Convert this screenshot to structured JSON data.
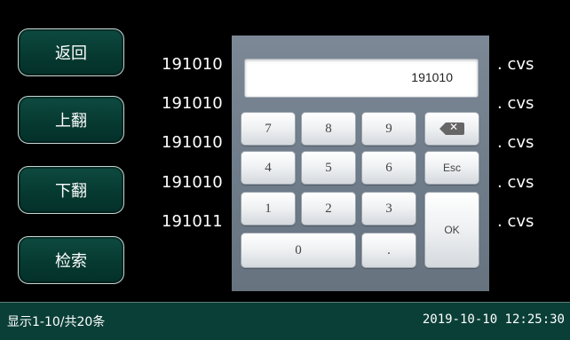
{
  "nav": {
    "back": "返回",
    "page_up": "上翻",
    "page_down": "下翻",
    "search": "检索"
  },
  "file_list": [
    {
      "name": "191010",
      "ext": ". cvs"
    },
    {
      "name": "191010",
      "ext": ". cvs"
    },
    {
      "name": "191010",
      "ext": ". cvs"
    },
    {
      "name": "191010",
      "ext": ". cvs"
    },
    {
      "name": "191011",
      "ext": ". cvs"
    }
  ],
  "keypad": {
    "display_value": "191010",
    "keys": {
      "k7": "7",
      "k8": "8",
      "k9": "9",
      "k4": "4",
      "k5": "5",
      "k6": "6",
      "k1": "1",
      "k2": "2",
      "k3": "3",
      "k0": "0",
      "dot": ".",
      "esc": "Esc",
      "ok": "OK",
      "backspace_icon": "backspace-icon"
    }
  },
  "status": {
    "summary": "显示1-10/共20条",
    "datetime": "2019-10-10 12:25:30"
  },
  "colors": {
    "background": "#000000",
    "button_fill": "#063a31",
    "status_bar": "#0a3f37",
    "keypad_panel": "#6e7b89"
  }
}
